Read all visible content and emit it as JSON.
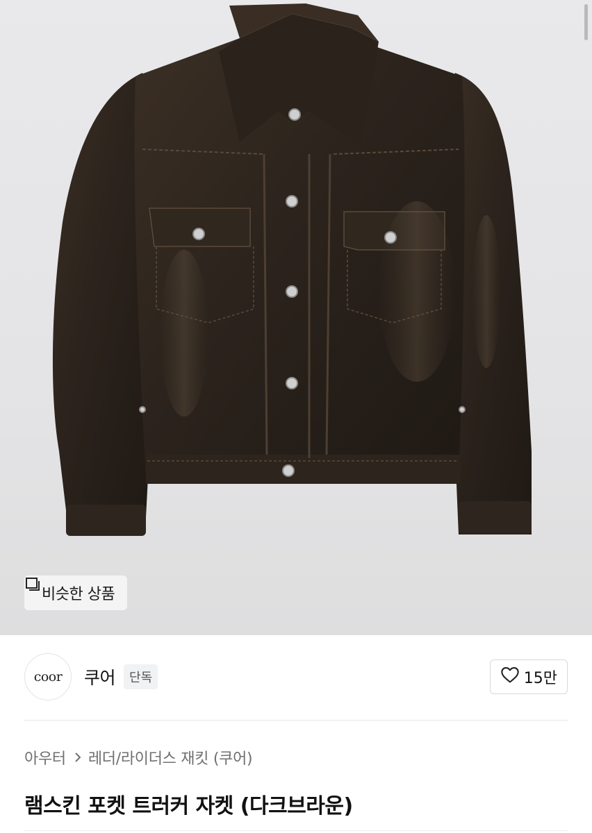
{
  "product_image": {
    "icon": "leather-jacket-photo",
    "similar_button_label": "비슷한 상품",
    "similar_icon": "similar-items-icon"
  },
  "seller": {
    "logo_text": "coor",
    "name": "쿠어",
    "badge": "단독"
  },
  "like": {
    "icon": "heart-outline-icon",
    "count": "15만"
  },
  "breadcrumb": {
    "category": "아우터",
    "subcategory": "레더/라이더스 재킷 (쿠어)"
  },
  "product": {
    "title": "램스킨 포켓 트러커 자켓 (다크브라운)"
  }
}
